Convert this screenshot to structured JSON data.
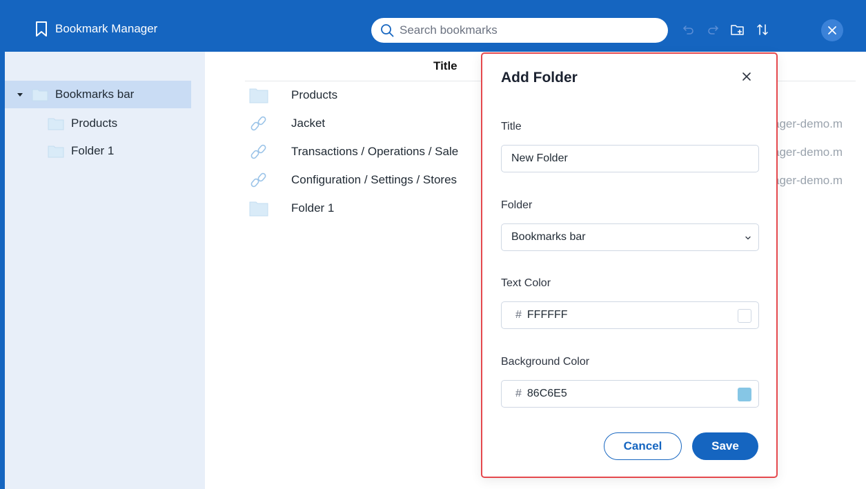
{
  "app": {
    "title": "Bookmark Manager"
  },
  "search": {
    "placeholder": "Search bookmarks"
  },
  "toolbar": {
    "icons": [
      "undo-icon",
      "redo-icon",
      "new-folder-icon",
      "sort-icon",
      "close-icon"
    ]
  },
  "sidebar": {
    "items": [
      {
        "label": "Bookmarks bar",
        "selected": true,
        "expanded": true
      },
      {
        "label": "Products"
      },
      {
        "label": "Folder 1"
      }
    ]
  },
  "list": {
    "header": "Title",
    "rows": [
      {
        "type": "folder",
        "title": "Products",
        "url": ""
      },
      {
        "type": "link",
        "title": "Jacket",
        "url": "ager-demo.m"
      },
      {
        "type": "link",
        "title": "Transactions / Operations / Sale",
        "url": "ager-demo.m"
      },
      {
        "type": "link",
        "title": "Configuration / Settings / Stores",
        "url": "ager-demo.m"
      },
      {
        "type": "folder",
        "title": "Folder 1",
        "url": ""
      }
    ]
  },
  "modal": {
    "title": "Add Folder",
    "title_label": "Title",
    "title_value": "New Folder",
    "folder_label": "Folder",
    "folder_value": "Bookmarks bar",
    "text_color_label": "Text Color",
    "text_color_hash": "#",
    "text_color_value": "FFFFFF",
    "bg_color_label": "Background Color",
    "bg_color_hash": "#",
    "bg_color_value": "86C6E5",
    "cancel_label": "Cancel",
    "save_label": "Save"
  },
  "colors": {
    "topbar": "#1565c0",
    "sidebar": "#e8eff9",
    "selected_row": "#c9dcf4",
    "folder_icon": "#d9ebf8",
    "accent": "#1565c0",
    "modal_border": "#e5484d",
    "text_color_swatch": "#FFFFFF",
    "bg_color_swatch": "#86C6E5"
  }
}
